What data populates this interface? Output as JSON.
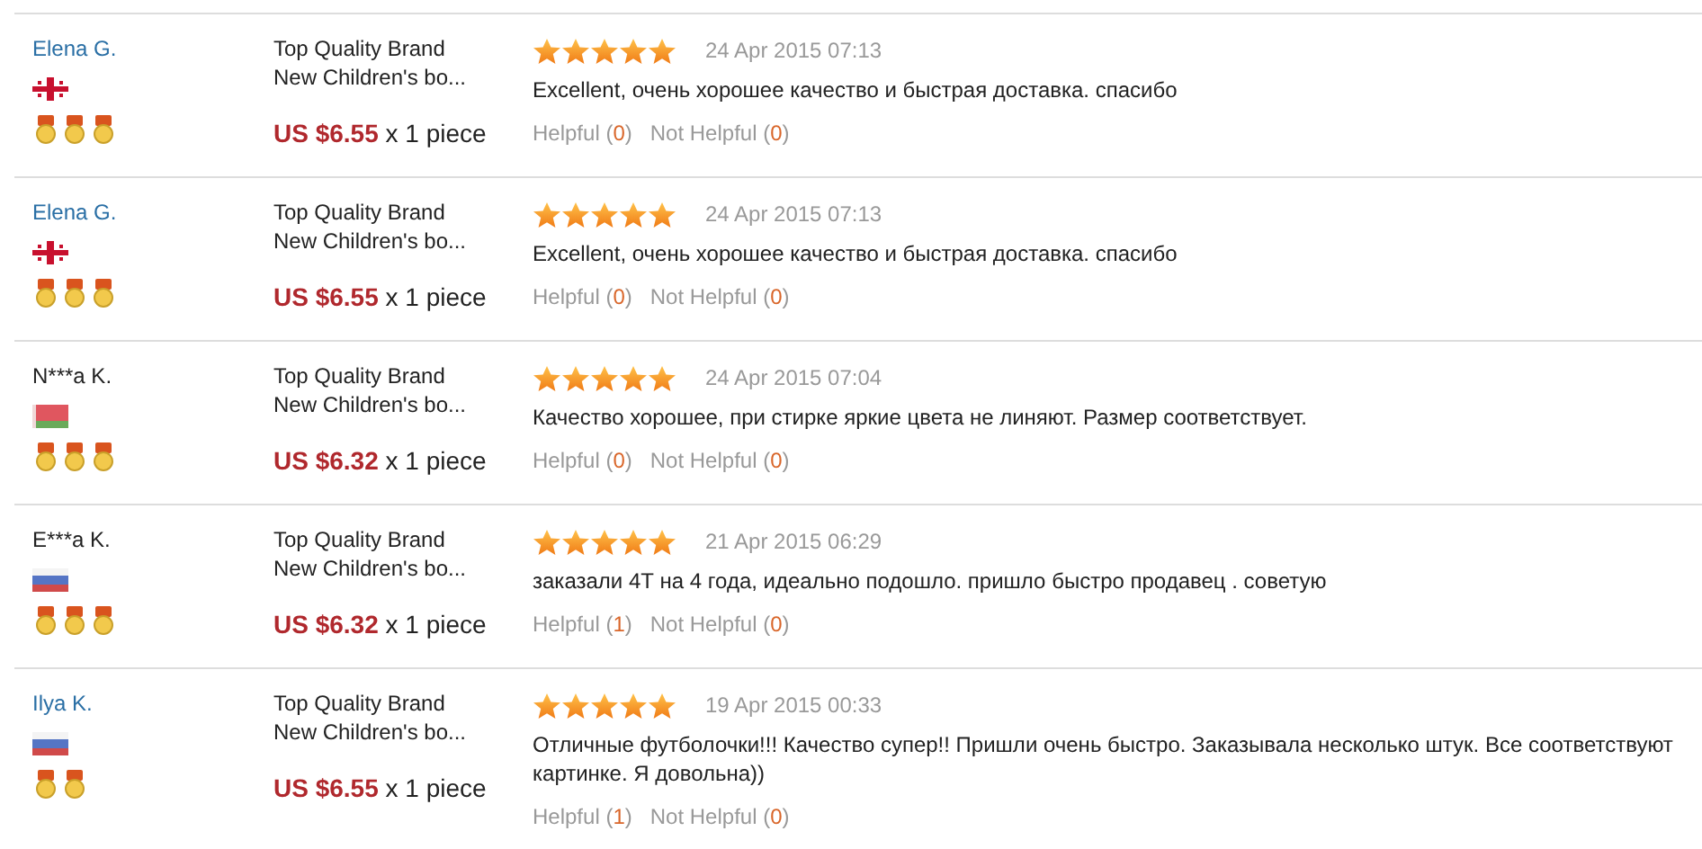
{
  "reviews": [
    {
      "buyer": {
        "name": "Elena G.",
        "linked": true,
        "flag": {
          "kind": "georgia"
        },
        "medals": [
          {
            "kind": "medal"
          },
          {
            "kind": "medal"
          },
          {
            "kind": "medal"
          }
        ]
      },
      "product": {
        "brand": "Top Quality Brand",
        "title": "New Children's bo...",
        "price": "US $6.55",
        "quantity": "x 1 piece"
      },
      "stars": 5,
      "date": "24 Apr 2015 07:13",
      "text": "Excellent, очень хорошее качество и быстрая доставка. спасибо",
      "helpful": {
        "label": "Helpful (",
        "count": "0",
        "close": ")"
      },
      "not_helpful": {
        "label": "Not Helpful (",
        "count": "0",
        "close": ")"
      }
    },
    {
      "buyer": {
        "name": "Elena G.",
        "linked": true,
        "flag": {
          "kind": "georgia"
        },
        "medals": [
          {
            "kind": "medal"
          },
          {
            "kind": "medal"
          },
          {
            "kind": "medal"
          }
        ]
      },
      "product": {
        "brand": "Top Quality Brand",
        "title": "New Children's bo...",
        "price": "US $6.55",
        "quantity": "x 1 piece"
      },
      "stars": 5,
      "date": "24 Apr 2015 07:13",
      "text": "Excellent, очень хорошее качество и быстрая доставка. спасибо",
      "helpful": {
        "label": "Helpful (",
        "count": "0",
        "close": ")"
      },
      "not_helpful": {
        "label": "Not Helpful (",
        "count": "0",
        "close": ")"
      }
    },
    {
      "buyer": {
        "name": "N***a K.",
        "linked": false,
        "flag": {
          "kind": "belarus"
        },
        "medals": [
          {
            "kind": "medal"
          },
          {
            "kind": "medal"
          },
          {
            "kind": "medal"
          }
        ]
      },
      "product": {
        "brand": "Top Quality Brand",
        "title": "New Children's bo...",
        "price": "US $6.32",
        "quantity": "x 1 piece"
      },
      "stars": 5,
      "date": "24 Apr 2015 07:04",
      "text": "Качество хорошее, при стирке яркие цвета не линяют. Размер соответствует.",
      "helpful": {
        "label": "Helpful (",
        "count": "0",
        "close": ")"
      },
      "not_helpful": {
        "label": "Not Helpful (",
        "count": "0",
        "close": ")"
      }
    },
    {
      "buyer": {
        "name": "E***a K.",
        "linked": false,
        "flag": {
          "kind": "russia"
        },
        "medals": [
          {
            "kind": "medal"
          },
          {
            "kind": "medal"
          },
          {
            "kind": "medal"
          }
        ]
      },
      "product": {
        "brand": "Top Quality Brand",
        "title": "New Children's bo...",
        "price": "US $6.32",
        "quantity": "x 1 piece"
      },
      "stars": 5,
      "date": "21 Apr 2015 06:29",
      "text": "заказали 4Т на 4 года, идеально подошло. пришло быстро продавец . советую",
      "helpful": {
        "label": "Helpful (",
        "count": "1",
        "close": ")"
      },
      "not_helpful": {
        "label": "Not Helpful (",
        "count": "0",
        "close": ")"
      }
    },
    {
      "buyer": {
        "name": "Ilya K.",
        "linked": true,
        "flag": {
          "kind": "russia"
        },
        "medals": [
          {
            "kind": "medal"
          },
          {
            "kind": "medal"
          }
        ]
      },
      "product": {
        "brand": "Top Quality Brand",
        "title": "New Children's bo...",
        "price": "US $6.55",
        "quantity": "x 1 piece"
      },
      "stars": 5,
      "date": "19 Apr 2015 00:33",
      "text": "Отличные футболочки!!! Качество супер!! Пришли очень быстро. Заказывала несколько штук. Все соответствуют картинке. Я довольна))",
      "helpful": {
        "label": "Helpful (",
        "count": "1",
        "close": ")"
      },
      "not_helpful": {
        "label": "Not Helpful (",
        "count": "0",
        "close": ")"
      }
    }
  ]
}
